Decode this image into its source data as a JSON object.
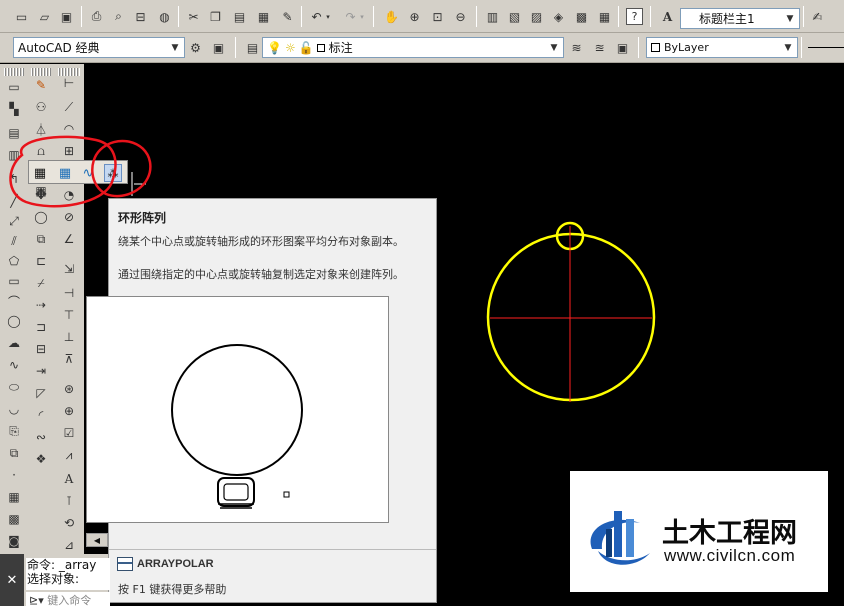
{
  "toolbar_top": {
    "textstyle_value": "标题栏主1",
    "icons": [
      "new-icon",
      "open-icon",
      "save-icon",
      "print-icon",
      "preview-icon",
      "publish-icon",
      "plot-icon",
      "cut-icon",
      "copy-icon",
      "paste-icon",
      "match-properties-icon",
      "undo-icon",
      "redo-icon",
      "pan-icon",
      "zoom-realtime-icon",
      "zoom-window-icon",
      "zoom-previous-icon",
      "properties-icon",
      "design-center-icon",
      "tool-palettes-icon",
      "markup-icon",
      "calculator-icon",
      "help-icon",
      "text-style-icon",
      "dimension-style-icon"
    ]
  },
  "toolbar_second": {
    "workspace_value": "AutoCAD 经典",
    "layer_value": "标注",
    "color_value": "ByLayer"
  },
  "tooltip": {
    "title": "环形阵列",
    "description_1": "绕某个中心点或旋转轴形成的环形图案平均分布对象副本。",
    "description_2": "通过围绕指定的中心点或旋转轴复制选定对象来创建阵列。",
    "command_name": "ARRAYPOLAR",
    "help_text": "按 F1 键获得更多帮助"
  },
  "command_line": {
    "line_1": "命令: _array",
    "line_2": "选择对象:",
    "input_placeholder": "键入命令"
  },
  "watermark": {
    "title": "土木工程网",
    "url": "www.civilcn.com"
  },
  "colors": {
    "canvas": "#000000",
    "drawing_circle": "#ffff00",
    "center_lines": "#ff0000",
    "annotation": "#e8131b",
    "toolbar": "#d4d0c8",
    "watermark_blue": "#1f5fb8"
  }
}
